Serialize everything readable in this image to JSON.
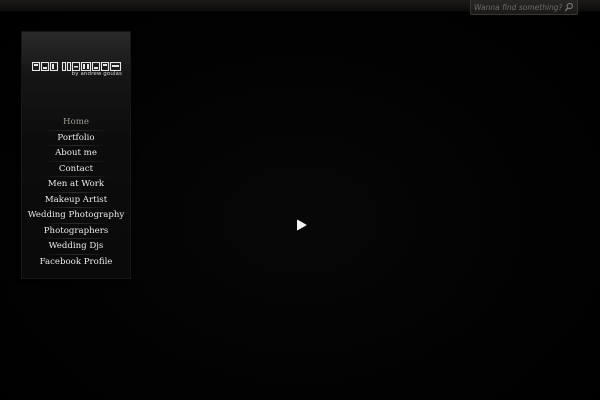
{
  "search": {
    "placeholder": "Wanna find something?",
    "icon": "search-icon"
  },
  "logo": {
    "mark_text": "ANDREW GOULAS",
    "tagline": "by andrew goulas"
  },
  "nav": {
    "items": [
      {
        "label": "Home",
        "active": true
      },
      {
        "label": "Portfolio",
        "active": false
      },
      {
        "label": "About me",
        "active": false
      },
      {
        "label": "Contact",
        "active": false
      },
      {
        "label": "Men at Work",
        "active": false
      },
      {
        "label": "Makeup Artist",
        "active": false
      },
      {
        "label": "Wedding Photography",
        "active": false
      },
      {
        "label": "Photographers",
        "active": false
      },
      {
        "label": "Wedding Djs",
        "active": false
      },
      {
        "label": "Facebook Profile",
        "active": false
      }
    ]
  },
  "player": {
    "icon": "play-icon"
  },
  "colors": {
    "background": "#020202",
    "nav_text": "#ececec",
    "nav_active": "#9d9a94",
    "search_text": "#6d6a64"
  }
}
